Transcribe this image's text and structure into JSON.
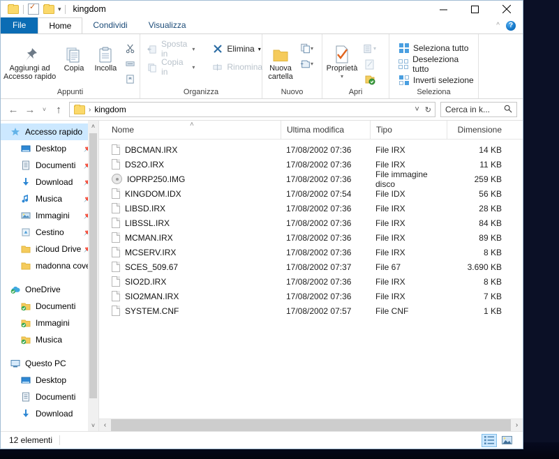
{
  "window": {
    "title": "kingdom",
    "quick_access": [
      "folder-icon",
      "properties-checkbox-icon",
      "new-folder-icon",
      "customize-caret-icon"
    ],
    "minimize_label": "Riduci a icona",
    "maximize_label": "Ingrandisci",
    "close_label": "Chiudi"
  },
  "ribbon": {
    "tabs": [
      {
        "label": "File",
        "kind": "file"
      },
      {
        "label": "Home",
        "kind": "active"
      },
      {
        "label": "Condividi",
        "kind": "normal"
      },
      {
        "label": "Visualizza",
        "kind": "normal"
      }
    ],
    "collapse_label": "^",
    "help_label": "?",
    "groups": [
      {
        "name": "Appunti",
        "big": [
          {
            "label": "Aggiungi ad\nAccesso rapido",
            "icon": "pin-icon"
          },
          {
            "label": "Copia",
            "icon": "copy-icon"
          },
          {
            "label": "Incolla",
            "icon": "paste-icon"
          }
        ],
        "small_icons": [
          "cut-scissors-icon",
          "copy-path-icon",
          "paste-shortcut-icon"
        ]
      },
      {
        "name": "Organizza",
        "items": [
          {
            "label": "Sposta in",
            "icon": "move-to-icon",
            "disabled": true,
            "caret": true
          },
          {
            "label": "Copia in",
            "icon": "copy-to-icon",
            "disabled": true,
            "caret": true
          },
          {
            "label": "Elimina",
            "icon": "delete-x-icon",
            "disabled": false,
            "caret": true
          },
          {
            "label": "Rinomina",
            "icon": "rename-icon",
            "disabled": true,
            "caret": false
          }
        ]
      },
      {
        "name": "Nuovo",
        "big": [
          {
            "label": "Nuova\ncartella",
            "icon": "new-folder-icon"
          }
        ],
        "small_icons": [
          "new-item-icon",
          "easy-access-icon"
        ]
      },
      {
        "name": "Apri",
        "big": [
          {
            "label": "Proprietà",
            "icon": "properties-icon",
            "caret": true
          }
        ],
        "small_icons": [
          "open-with-icon",
          "edit-icon",
          "history-icon"
        ]
      },
      {
        "name": "Seleziona",
        "items": [
          {
            "label": "Seleziona tutto",
            "icon": "select-all-icon"
          },
          {
            "label": "Deseleziona tutto",
            "icon": "select-none-icon"
          },
          {
            "label": "Inverti selezione",
            "icon": "invert-selection-icon"
          }
        ]
      }
    ]
  },
  "addressbar": {
    "back_label": "←",
    "forward_label": "→",
    "recent_label": "˅",
    "up_label": "↑",
    "crumb_icon": "folder-icon",
    "crumb_sep": "›",
    "path": "kingdom",
    "history_caret": "˅",
    "refresh_label": "↻",
    "search_placeholder": "Cerca in k...",
    "search_icon": "search-icon"
  },
  "navpane": {
    "groups": [
      {
        "items": [
          {
            "label": "Accesso rapido",
            "icon": "star-icon",
            "selected": true,
            "indent": 0,
            "pinned": false
          },
          {
            "label": "Desktop",
            "icon": "desktop-icon",
            "indent": 1,
            "pinned": true
          },
          {
            "label": "Documenti",
            "icon": "documents-icon",
            "indent": 1,
            "pinned": true
          },
          {
            "label": "Download",
            "icon": "download-icon",
            "indent": 1,
            "pinned": true
          },
          {
            "label": "Musica",
            "icon": "music-note-icon",
            "indent": 1,
            "pinned": true
          },
          {
            "label": "Immagini",
            "icon": "pictures-icon",
            "indent": 1,
            "pinned": true
          },
          {
            "label": "Cestino",
            "icon": "recycle-bin-icon",
            "indent": 1,
            "pinned": true
          },
          {
            "label": "iCloud Drive",
            "icon": "folder-icon",
            "indent": 1,
            "pinned": true
          },
          {
            "label": "madonna cover",
            "icon": "folder-icon",
            "indent": 1,
            "pinned": false
          }
        ]
      },
      {
        "items": [
          {
            "label": "OneDrive",
            "icon": "onedrive-icon",
            "indent": 0,
            "pinned": false
          },
          {
            "label": "Documenti",
            "icon": "folder-sync-icon",
            "indent": 1,
            "pinned": false
          },
          {
            "label": "Immagini",
            "icon": "folder-sync-icon",
            "indent": 1,
            "pinned": false
          },
          {
            "label": "Musica",
            "icon": "folder-sync-icon",
            "indent": 1,
            "pinned": false
          }
        ]
      },
      {
        "items": [
          {
            "label": "Questo PC",
            "icon": "this-pc-icon",
            "indent": 0,
            "pinned": false
          },
          {
            "label": "Desktop",
            "icon": "desktop-icon",
            "indent": 1,
            "pinned": false
          },
          {
            "label": "Documenti",
            "icon": "documents-icon",
            "indent": 1,
            "pinned": false
          },
          {
            "label": "Download",
            "icon": "download-icon",
            "indent": 1,
            "pinned": false
          }
        ]
      }
    ],
    "scroll_up": "˄",
    "scroll_down": "˅"
  },
  "filelist": {
    "columns": [
      {
        "label": "Nome",
        "key": "name"
      },
      {
        "label": "Ultima modifica",
        "key": "date"
      },
      {
        "label": "Tipo",
        "key": "type"
      },
      {
        "label": "Dimensione",
        "key": "size"
      }
    ],
    "sort_indicator": "˄",
    "rows": [
      {
        "name": "DBCMAN.IRX",
        "date": "17/08/2002 07:36",
        "type": "File IRX",
        "size": "14 KB",
        "icon": "file-icon"
      },
      {
        "name": "DS2O.IRX",
        "date": "17/08/2002 07:36",
        "type": "File IRX",
        "size": "11 KB",
        "icon": "file-icon"
      },
      {
        "name": "IOPRP250.IMG",
        "date": "17/08/2002 07:36",
        "type": "File immagine disco",
        "size": "259 KB",
        "icon": "disc-image-icon"
      },
      {
        "name": "KINGDOM.IDX",
        "date": "17/08/2002 07:54",
        "type": "File IDX",
        "size": "56 KB",
        "icon": "file-icon"
      },
      {
        "name": "LIBSD.IRX",
        "date": "17/08/2002 07:36",
        "type": "File IRX",
        "size": "28 KB",
        "icon": "file-icon"
      },
      {
        "name": "LIBSSL.IRX",
        "date": "17/08/2002 07:36",
        "type": "File IRX",
        "size": "84 KB",
        "icon": "file-icon"
      },
      {
        "name": "MCMAN.IRX",
        "date": "17/08/2002 07:36",
        "type": "File IRX",
        "size": "89 KB",
        "icon": "file-icon"
      },
      {
        "name": "MCSERV.IRX",
        "date": "17/08/2002 07:36",
        "type": "File IRX",
        "size": "8 KB",
        "icon": "file-icon"
      },
      {
        "name": "SCES_509.67",
        "date": "17/08/2002 07:37",
        "type": "File 67",
        "size": "3.690 KB",
        "icon": "file-icon"
      },
      {
        "name": "SIO2D.IRX",
        "date": "17/08/2002 07:36",
        "type": "File IRX",
        "size": "8 KB",
        "icon": "file-icon"
      },
      {
        "name": "SIO2MAN.IRX",
        "date": "17/08/2002 07:36",
        "type": "File IRX",
        "size": "7 KB",
        "icon": "file-icon"
      },
      {
        "name": "SYSTEM.CNF",
        "date": "17/08/2002 07:57",
        "type": "File CNF",
        "size": "1 KB",
        "icon": "file-icon"
      }
    ],
    "hscroll_left": "‹",
    "hscroll_right": "›"
  },
  "statusbar": {
    "item_count": "12 elementi",
    "views": [
      {
        "name": "details-view",
        "active": true
      },
      {
        "name": "large-icons-view",
        "active": false
      }
    ]
  },
  "colors": {
    "file_tab": "#0b6cb4",
    "selection": "#cce8ff",
    "folder_yellow": "#fbd96b",
    "accent_blue": "#1477c8"
  }
}
